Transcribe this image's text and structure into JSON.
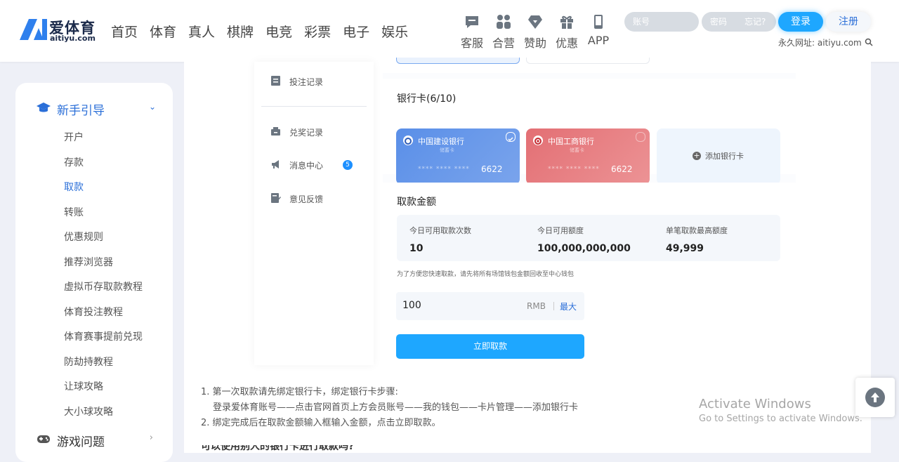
{
  "brand": {
    "name": "爱体育",
    "domain": "aitiyu.com"
  },
  "nav": [
    "首页",
    "体育",
    "真人",
    "棋牌",
    "电竞",
    "彩票",
    "电子",
    "娱乐"
  ],
  "tools": [
    {
      "label": "客服",
      "icon": "chat-icon"
    },
    {
      "label": "合营",
      "icon": "people-icon"
    },
    {
      "label": "赞助",
      "icon": "diamond-icon"
    },
    {
      "label": "优惠",
      "icon": "gift-icon"
    },
    {
      "label": "APP",
      "icon": "phone-icon"
    }
  ],
  "login": {
    "account_placeholder": "账号",
    "password_placeholder": "密码",
    "forgot": "忘记?",
    "login_label": "登录",
    "register_label": "注册",
    "permanent": "永久网址: aitiyu.com"
  },
  "sidebar": {
    "section_title": "新手引导",
    "items": [
      "开户",
      "存款",
      "取款",
      "转账",
      "优惠规则",
      "推荐浏览器",
      "虚拟币存取款教程",
      "体育投注教程",
      "体育赛事提前兑现",
      "防劫持教程",
      "让球攻略",
      "大小球攻略"
    ],
    "active": "取款",
    "section2_title": "游戏问题"
  },
  "subnav": {
    "items": [
      {
        "label": "投注记录",
        "icon": "document-icon"
      },
      {
        "label": "兑奖记录",
        "icon": "tray-icon"
      },
      {
        "label": "消息中心",
        "icon": "megaphone-icon",
        "badge": "5"
      },
      {
        "label": "意见反馈",
        "icon": "edit-icon"
      }
    ]
  },
  "bank_section": {
    "title": "银行卡(6/10)",
    "cards": [
      {
        "name": "中国建设银行",
        "type": "储蓄卡",
        "mask": "**** **** ****",
        "last4": "6622",
        "color": "#5a8fe8"
      },
      {
        "name": "中国工商银行",
        "type": "储蓄卡",
        "mask": "**** **** ****",
        "last4": "6622",
        "color": "#e36f74"
      }
    ],
    "add_label": "添加银行卡"
  },
  "withdraw": {
    "title": "取款金额",
    "limits": [
      {
        "label": "今日可用取款次数",
        "value": "10"
      },
      {
        "label": "今日可用额度",
        "value": "100,000,000,000"
      },
      {
        "label": "单笔取款最高额度",
        "value": "49,999"
      }
    ],
    "hint": "为了方便您快速取款，请先将所有场馆钱包金额回收至中心钱包",
    "amount": "100",
    "unit": "RMB",
    "max_label": "最大",
    "submit_label": "立即取款"
  },
  "notes": {
    "line1": "1. 第一次取款请先绑定银行卡，绑定银行卡步骤:",
    "line2": "登录爱体育账号——点击官网首页上方会员账号——我的钱包——卡片管理——添加银行卡",
    "line3": "2. 绑定完成后在取款金额输入框输入金额，点击立即取款。",
    "line4": "可以使用别人的银行卡进行取款吗?"
  },
  "watermark": {
    "title": "Activate Windows",
    "subtitle": "Go to Settings to activate Windows."
  }
}
